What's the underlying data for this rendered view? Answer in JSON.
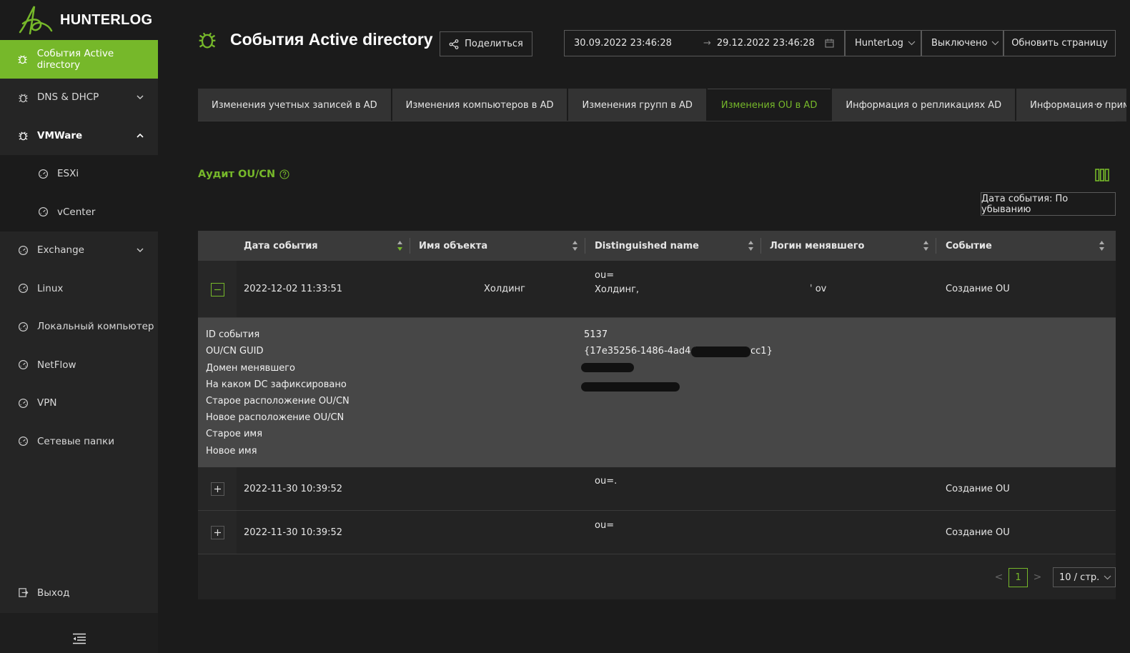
{
  "app": {
    "name": "HUNTERLOG"
  },
  "sidebar": {
    "items": [
      {
        "label": "События Active directory",
        "icon": "bug-icon",
        "active": true
      },
      {
        "label": "DNS & DHCP",
        "icon": "bug-icon",
        "expandable": true
      },
      {
        "label": "VMWare",
        "icon": "bug-icon",
        "expandable": true,
        "open": true
      },
      {
        "label": "ESXi",
        "icon": "gauge-icon",
        "sub": true
      },
      {
        "label": "vCenter",
        "icon": "gauge-icon",
        "sub": true
      },
      {
        "label": "Exchange",
        "icon": "gauge-icon",
        "expandable": true
      },
      {
        "label": "Linux",
        "icon": "gauge-icon"
      },
      {
        "label": "Локальный компьютер",
        "icon": "gauge-icon"
      },
      {
        "label": "NetFlow",
        "icon": "gauge-icon"
      },
      {
        "label": "VPN",
        "icon": "gauge-icon"
      },
      {
        "label": "Сетевые папки",
        "icon": "gauge-icon"
      }
    ],
    "logout": "Выход"
  },
  "header": {
    "title": "События Active directory",
    "share": "Поделиться",
    "date_from": "30.09.2022 23:46:28",
    "date_arrow": "→",
    "date_to": "29.12.2022 23:46:28",
    "source_select": "HunterLog",
    "mode_select": "Выключено",
    "refresh": "Обновить страницу"
  },
  "tabs": [
    {
      "label": "Изменения учетных записей в AD"
    },
    {
      "label": "Изменения компьютеров в AD"
    },
    {
      "label": "Изменения групп в AD"
    },
    {
      "label": "Изменения OU в AD",
      "active": true
    },
    {
      "label": "Информация о репликациях AD"
    },
    {
      "label": "Информация о применении"
    }
  ],
  "tabs_more": "···",
  "section": {
    "title": "Аудит OU/CN",
    "help_icon": "question-circle-icon"
  },
  "sort": {
    "label": "Дата события: По убыванию"
  },
  "table": {
    "columns": [
      "Дата события",
      "Имя объекта",
      "Distinguished name",
      "Логин менявшего",
      "Событие"
    ],
    "rows": [
      {
        "date": "2022-12-02 11:33:51",
        "object": "Холдинг",
        "dn_line1": "ou=",
        "dn_line2": "Холдинг,",
        "login": "ˈ ov",
        "event": "Создание OU",
        "expanded": true
      },
      {
        "date": "2022-11-30 10:39:52",
        "object": "",
        "dn_line1": "ou=.",
        "dn_line2": "",
        "login": "",
        "event": "Создание OU",
        "expanded": false
      },
      {
        "date": "2022-11-30 10:39:52",
        "object": "",
        "dn_line1": "ou=",
        "dn_line2": "",
        "login": "",
        "event": "Создание OU",
        "expanded": false
      }
    ],
    "detail": {
      "labels": [
        "ID события",
        "OU/CN GUID",
        "Домен менявшего",
        "На каком DC зафиксировано",
        "Старое расположение OU/CN",
        "Новое расположение OU/CN",
        "Старое имя",
        "Новое имя"
      ],
      "values": [
        "5137",
        "{17e35256-1486-4ad4-b4",
        "cc1}",
        "",
        "",
        "",
        "",
        ""
      ]
    }
  },
  "pagination": {
    "current": "1",
    "page_size": "10 / стр.",
    "prev": "<",
    "next": ">"
  },
  "colors": {
    "accent": "#76b82a",
    "sidebar_bg": "#252525",
    "page_bg": "#1b1b1b"
  }
}
